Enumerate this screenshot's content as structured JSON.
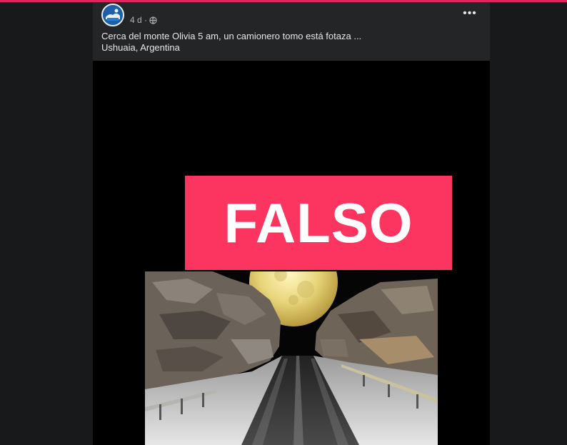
{
  "post": {
    "time": "4 d ·",
    "privacy_icon": "globe-icon",
    "more_icon": "more-options-icon",
    "more_label": "•••",
    "caption_line1": "Cerca del monte Olivia 5 am, un camionero tomo está fotaza ...",
    "caption_line2": "Ushuaia, Argentina"
  },
  "image": {
    "stamp_text": "FALSO",
    "stamp_color": "#fb3560",
    "subject": "full moon over snowy road between rocky cliffs"
  },
  "colors": {
    "accent_top": "#e0245e",
    "post_bg": "#242526",
    "page_bg": "#18191a"
  }
}
